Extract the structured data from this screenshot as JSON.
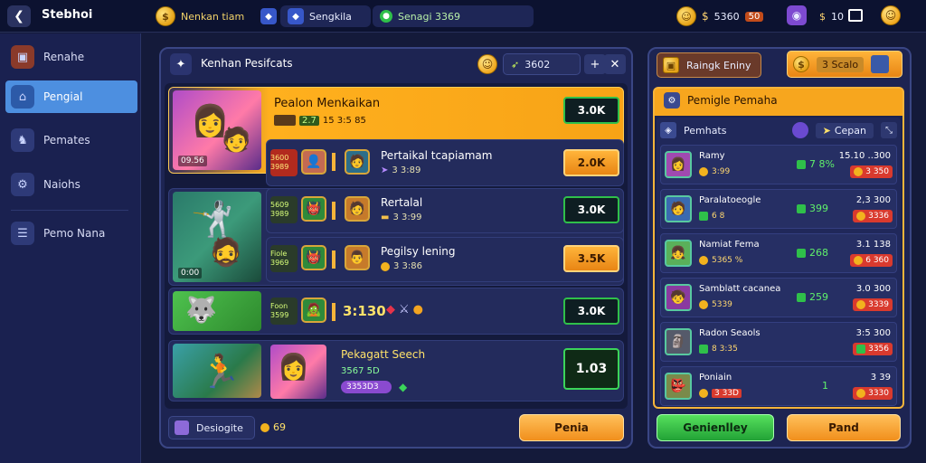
{
  "topbar": {
    "app_title": "Stebhoi",
    "currency_label": "Nenkan tiam",
    "status1": "Sengkila",
    "status2": "Senagi 3369",
    "gold_amount": "5360",
    "gems_amount": "50",
    "energy_amount": "10"
  },
  "sidebar": {
    "items": [
      {
        "label": "Renahe",
        "icon": "chest-icon"
      },
      {
        "label": "Pengial",
        "icon": "home-icon"
      },
      {
        "label": "Pemates",
        "icon": "knight-icon"
      },
      {
        "label": "Naiohs",
        "icon": "gear-icon"
      },
      {
        "label": "Pemo Nana",
        "icon": "list-icon"
      }
    ]
  },
  "main": {
    "title": "Kenhan Pesifcats",
    "coin_value": "3602",
    "rows": [
      {
        "name": "Pealon Menkaikan",
        "sub1": "2.7",
        "sub2": "15 3:5 85",
        "thumb_label": "09.56",
        "value": "3.0K",
        "style": "green"
      },
      {
        "name": "Pertaikal tcapiamam",
        "tag": "3600 3989",
        "sub": "3 3:89",
        "value": "2.0K",
        "style": "orange"
      },
      {
        "name": "Rertalal",
        "tag": "5609 3989",
        "sub": "3 3:99",
        "thumb_label": "0:00",
        "value": "3.0K",
        "style": "green"
      },
      {
        "name": "Pegilsy lening",
        "tag": "Fiole 3969",
        "sub": "3 3:86",
        "value": "3.5K",
        "style": "orange"
      },
      {
        "name": "3:130",
        "tag": "Foon 3599",
        "value": "3.0K",
        "style": "green"
      },
      {
        "name": "Pekagatt Seech",
        "sub1": "3567 5D",
        "sub2": "3353D3",
        "value": "1.03",
        "style": "dark"
      }
    ],
    "footer_label": "Desiogite",
    "footer_value": "69",
    "footer_button": "Penia"
  },
  "right": {
    "btn_left": "Raingk Eniny",
    "btn_right": "3 Scalo",
    "inner_title": "Pemigle Pemaha",
    "list_title": "Pemhats",
    "filter_label": "Cepan",
    "rows": [
      {
        "name": "Ramy",
        "sub": "3:99",
        "mid": "7 8%",
        "right_top": "15.10 ..300",
        "right_bot": "3 350",
        "emoji": "👩"
      },
      {
        "name": "Paralatoeogle",
        "sub": "6 8",
        "mid": "399",
        "right_top": "2,3 300",
        "right_bot": "3336",
        "emoji": "🧑"
      },
      {
        "name": "Namiat Fema",
        "sub": "5365 %",
        "mid": "268",
        "right_top": "3.1 138",
        "right_bot": "6 360",
        "emoji": "👧"
      },
      {
        "name": "Samblatt cacanea",
        "sub": "5339",
        "mid": "259",
        "right_top": "3.0 300",
        "right_bot": "3339",
        "emoji": "🧒"
      },
      {
        "name": "Radon Seaols",
        "sub": "8 3:35",
        "mid": "",
        "right_top": "3:5 300",
        "right_bot": "3356",
        "emoji": "🗿"
      },
      {
        "name": "Poniain",
        "sub": "3 33D",
        "mid": "1",
        "right_top": "3 39",
        "right_bot": "3330",
        "emoji": "👺"
      }
    ],
    "btn_green": "Genienlley",
    "btn_orange": "Pand"
  }
}
